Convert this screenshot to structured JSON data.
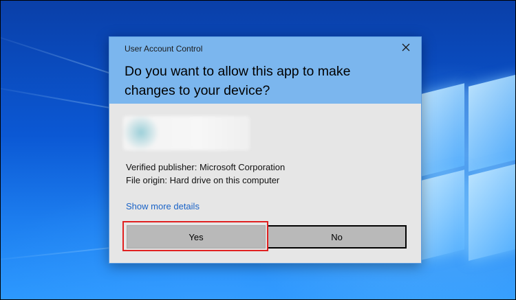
{
  "dialog": {
    "title": "User Account Control",
    "question": "Do you want to allow this app to make changes to your device?",
    "publisher_line": "Verified publisher: Microsoft Corporation",
    "origin_line": "File origin: Hard drive on this computer",
    "more_details_label": "Show more details",
    "yes_label": "Yes",
    "no_label": "No",
    "close_icon": "close-icon"
  },
  "colors": {
    "header_bg": "#7bb6ee",
    "body_bg": "#e6e6e6",
    "button_bg": "#b9b9b9",
    "link": "#1a63c7",
    "highlight": "#e02020",
    "desktop_blue": "#0b58d4"
  }
}
